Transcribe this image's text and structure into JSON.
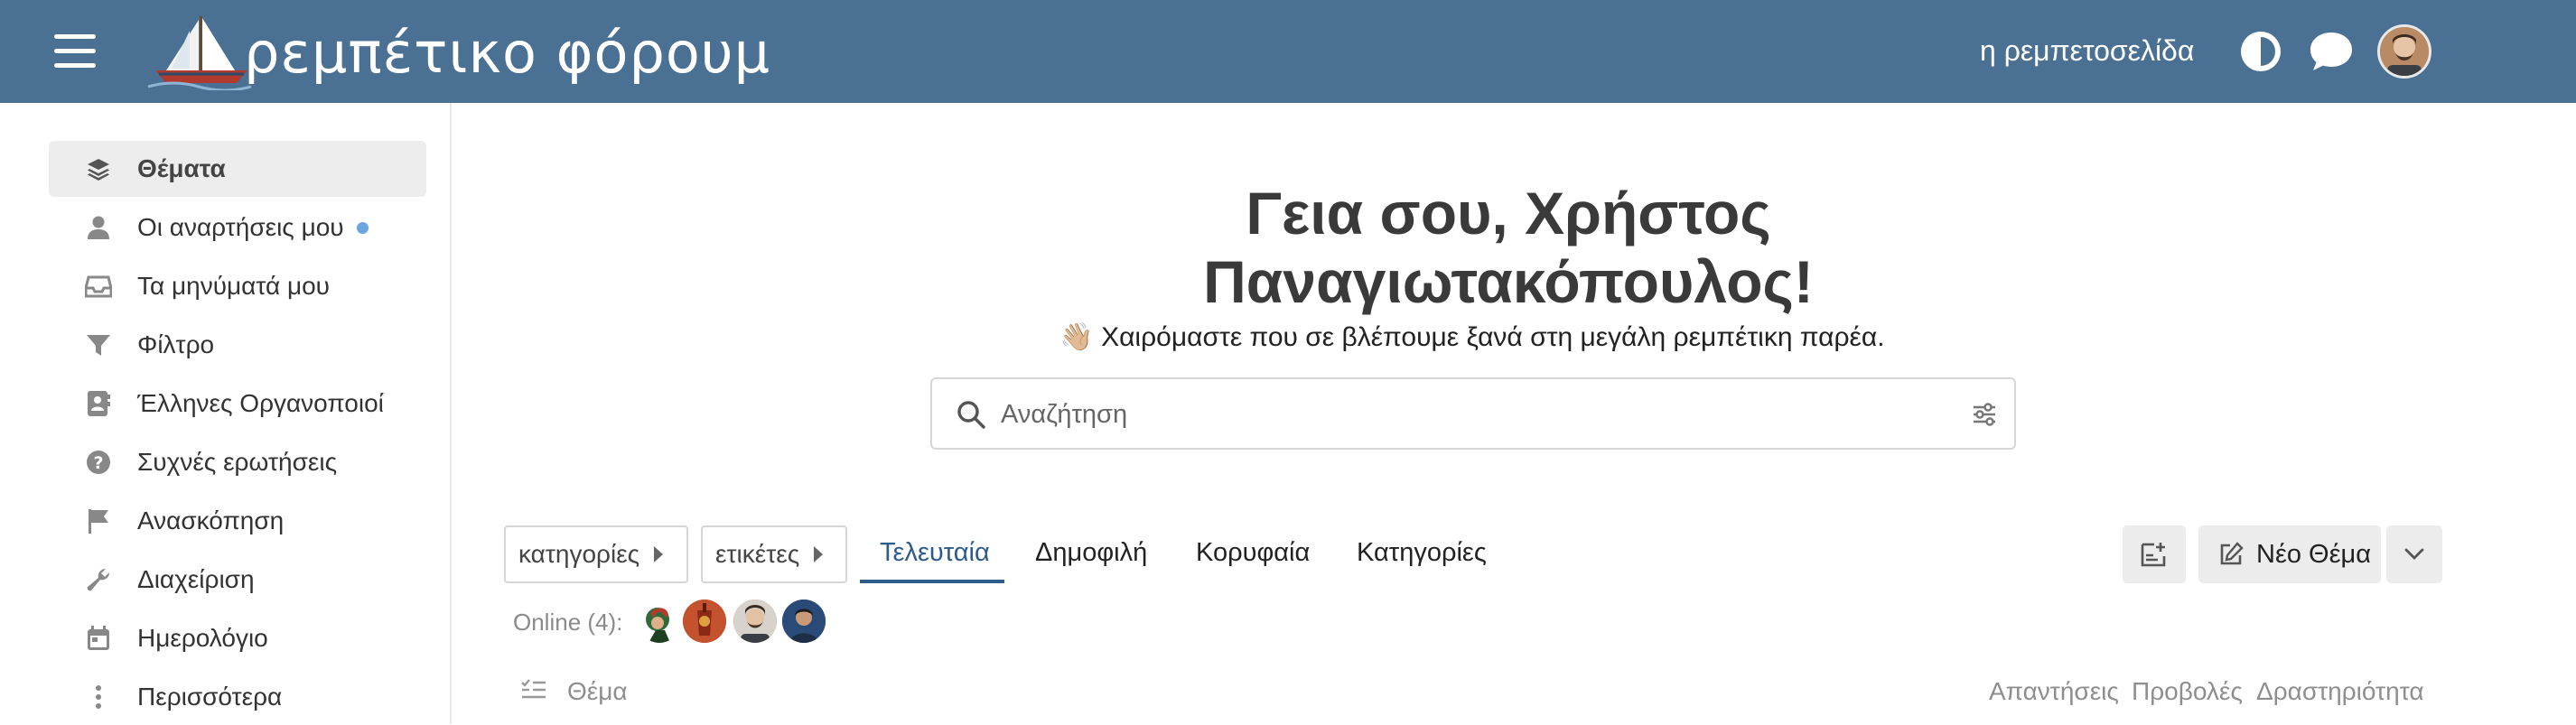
{
  "header": {
    "site_title": "ρεμπέτικο φόρουμ",
    "home_link": "η ρεμπετοσελίδα",
    "bg_color": "#4a7093",
    "icons": [
      "menu-icon",
      "theme-toggle-icon",
      "chat-icon",
      "user-avatar"
    ]
  },
  "sidebar": {
    "items": [
      {
        "label": "Θέματα",
        "icon": "layers-icon",
        "active": true
      },
      {
        "label": "Οι αναρτήσεις μου",
        "icon": "user-icon"
      },
      {
        "label": "Τα μηνύματά μου",
        "icon": "inbox-icon"
      },
      {
        "label": "Φίλτρο",
        "icon": "filter-icon"
      },
      {
        "label": "Έλληνες Οργανοποιοί",
        "icon": "contact-card-icon"
      },
      {
        "label": "Συχνές ερωτήσεις",
        "icon": "question-icon"
      },
      {
        "label": "Ανασκόπηση",
        "icon": "flag-icon"
      },
      {
        "label": "Διαχείριση",
        "icon": "wrench-icon"
      },
      {
        "label": "Ημερολόγιο",
        "icon": "calendar-icon"
      },
      {
        "label": "Περισσότερα",
        "icon": "more-vertical-icon"
      }
    ]
  },
  "welcome": {
    "line1": "Γεια σου, Χρήστος",
    "line2": "Παναγιωτακόπουλος!",
    "subtitle": "👋🏼 Χαιρόμαστε που σε βλέπουμε ξανά στη μεγάλη ρεμπέτικη παρέα."
  },
  "search": {
    "placeholder": "Αναζήτηση"
  },
  "nav": {
    "categories_dropdown": "κατηγορίες",
    "tags_dropdown": "ετικέτες",
    "tabs": [
      "Τελευταία",
      "Δημοφιλή",
      "Κορυφαία",
      "Κατηγορίες"
    ],
    "active_tab": "Τελευταία",
    "new_topic": "Νέο Θέμα",
    "accent_color": "#2e5c8a"
  },
  "online": {
    "label": "Online (4):"
  },
  "table_header": {
    "topic": "Θέμα",
    "replies": "Απαντήσεις",
    "views": "Προβολές",
    "activity": "Δραστηριότητα"
  }
}
